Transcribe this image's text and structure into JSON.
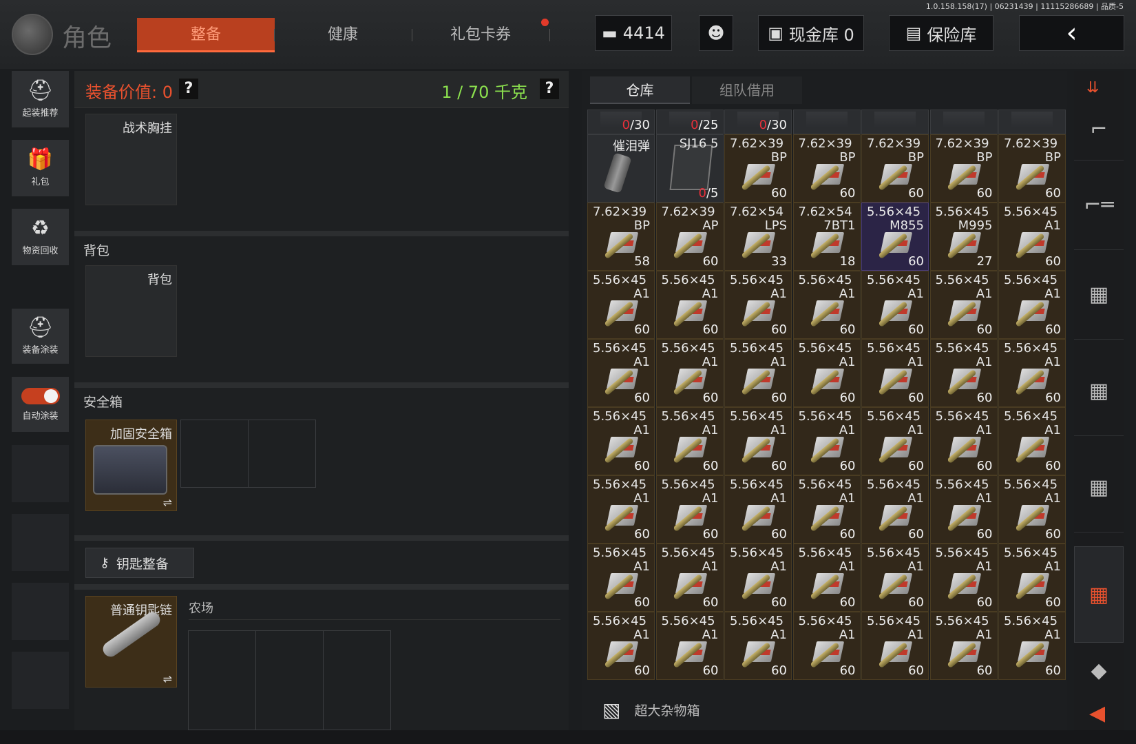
{
  "version": "1.0.158.158(17) | 06231439 | 11115286689 | 品质-5",
  "header": {
    "page_title": "角色",
    "tabs": [
      {
        "label": "整备",
        "active": true
      },
      {
        "label": "健康",
        "active": false
      },
      {
        "label": "礼包卡券",
        "active": false
      }
    ],
    "money": "4414",
    "cash_vault": "现金库 0",
    "insurance": "保险库",
    "back_icon": "back-arrow-icon"
  },
  "sidebar": [
    {
      "label": "起装推荐",
      "icon": "helmet-icon"
    },
    {
      "label": "礼包",
      "icon": "gift-icon"
    },
    {
      "label": "物资回收",
      "icon": "recycle-icon"
    },
    {
      "label": "装备涂装",
      "icon": "paint-icon"
    },
    {
      "label": "自动涂装",
      "icon": "toggle-icon"
    }
  ],
  "loadout": {
    "equip_value": "装备价值: 0",
    "weight": "1 / 70 千克",
    "help": "?",
    "chest_rig_label": "战术胸挂",
    "backpack_section": "背包",
    "backpack_slot": "背包",
    "safebox_section": "安全箱",
    "safebox_item": "加固安全箱",
    "key_button": "钥匙整备",
    "keychain_item": "普通钥匙链",
    "farm_label": "农场",
    "swap_icon": "⇌"
  },
  "warehouse": {
    "tabs": [
      {
        "label": "仓库",
        "active": true
      },
      {
        "label": "组队借用",
        "active": false
      }
    ],
    "misc_box": "超大杂物箱",
    "rows": [
      [
        {
          "name": "",
          "variant": "",
          "count": "/30",
          "count_red": "0",
          "kind": "partial"
        },
        {
          "name": "",
          "variant": "",
          "count": "/25",
          "count_red": "0",
          "kind": "partial"
        },
        {
          "name": "",
          "variant": "",
          "count": "/30",
          "count_red": "0",
          "kind": "partial"
        },
        {
          "name": "",
          "variant": "",
          "count": "",
          "count_red": "",
          "kind": "partial"
        },
        {
          "name": "",
          "variant": "",
          "count": "",
          "count_red": "",
          "kind": "partial"
        },
        {
          "name": "",
          "variant": "",
          "count": "",
          "count_red": "",
          "kind": "partial"
        },
        {
          "name": "",
          "variant": "",
          "count": "",
          "count_red": "",
          "kind": "partial"
        }
      ],
      [
        {
          "name": "催泪弹",
          "variant": "",
          "count": "",
          "count_red": "",
          "kind": "grenade"
        },
        {
          "name": "SJ16 5",
          "variant": "",
          "count": "/5",
          "count_red": "0",
          "kind": "magazine"
        },
        {
          "name": "7.62×39",
          "variant": "BP",
          "count": "60",
          "count_red": "",
          "kind": "ammo"
        },
        {
          "name": "7.62×39",
          "variant": "BP",
          "count": "60",
          "count_red": "",
          "kind": "ammo"
        },
        {
          "name": "7.62×39",
          "variant": "BP",
          "count": "60",
          "count_red": "",
          "kind": "ammo"
        },
        {
          "name": "7.62×39",
          "variant": "BP",
          "count": "60",
          "count_red": "",
          "kind": "ammo"
        },
        {
          "name": "7.62×39",
          "variant": "BP",
          "count": "60",
          "count_red": "",
          "kind": "ammo"
        }
      ],
      [
        {
          "name": "7.62×39",
          "variant": "BP",
          "count": "58",
          "count_red": "",
          "kind": "ammo"
        },
        {
          "name": "7.62×39",
          "variant": "AP",
          "count": "60",
          "count_red": "",
          "kind": "ammo"
        },
        {
          "name": "7.62×54",
          "variant": "LPS",
          "count": "33",
          "count_red": "",
          "kind": "ammo"
        },
        {
          "name": "7.62×54",
          "variant": "7BT1",
          "count": "18",
          "count_red": "",
          "kind": "ammo"
        },
        {
          "name": "5.56×45",
          "variant": "M855",
          "count": "60",
          "count_red": "",
          "kind": "ammo-purple"
        },
        {
          "name": "5.56×45",
          "variant": "M995",
          "count": "27",
          "count_red": "",
          "kind": "ammo"
        },
        {
          "name": "5.56×45",
          "variant": "A1",
          "count": "60",
          "count_red": "",
          "kind": "ammo"
        }
      ],
      [
        {
          "name": "5.56×45",
          "variant": "A1",
          "count": "60",
          "count_red": "",
          "kind": "ammo"
        },
        {
          "name": "5.56×45",
          "variant": "A1",
          "count": "60",
          "count_red": "",
          "kind": "ammo"
        },
        {
          "name": "5.56×45",
          "variant": "A1",
          "count": "60",
          "count_red": "",
          "kind": "ammo"
        },
        {
          "name": "5.56×45",
          "variant": "A1",
          "count": "60",
          "count_red": "",
          "kind": "ammo"
        },
        {
          "name": "5.56×45",
          "variant": "A1",
          "count": "60",
          "count_red": "",
          "kind": "ammo"
        },
        {
          "name": "5.56×45",
          "variant": "A1",
          "count": "60",
          "count_red": "",
          "kind": "ammo"
        },
        {
          "name": "5.56×45",
          "variant": "A1",
          "count": "60",
          "count_red": "",
          "kind": "ammo"
        }
      ],
      [
        {
          "name": "5.56×45",
          "variant": "A1",
          "count": "60",
          "count_red": "",
          "kind": "ammo"
        },
        {
          "name": "5.56×45",
          "variant": "A1",
          "count": "60",
          "count_red": "",
          "kind": "ammo"
        },
        {
          "name": "5.56×45",
          "variant": "A1",
          "count": "60",
          "count_red": "",
          "kind": "ammo"
        },
        {
          "name": "5.56×45",
          "variant": "A1",
          "count": "60",
          "count_red": "",
          "kind": "ammo"
        },
        {
          "name": "5.56×45",
          "variant": "A1",
          "count": "60",
          "count_red": "",
          "kind": "ammo"
        },
        {
          "name": "5.56×45",
          "variant": "A1",
          "count": "60",
          "count_red": "",
          "kind": "ammo"
        },
        {
          "name": "5.56×45",
          "variant": "A1",
          "count": "60",
          "count_red": "",
          "kind": "ammo"
        }
      ],
      [
        {
          "name": "5.56×45",
          "variant": "A1",
          "count": "60",
          "count_red": "",
          "kind": "ammo"
        },
        {
          "name": "5.56×45",
          "variant": "A1",
          "count": "60",
          "count_red": "",
          "kind": "ammo"
        },
        {
          "name": "5.56×45",
          "variant": "A1",
          "count": "60",
          "count_red": "",
          "kind": "ammo"
        },
        {
          "name": "5.56×45",
          "variant": "A1",
          "count": "60",
          "count_red": "",
          "kind": "ammo"
        },
        {
          "name": "5.56×45",
          "variant": "A1",
          "count": "60",
          "count_red": "",
          "kind": "ammo"
        },
        {
          "name": "5.56×45",
          "variant": "A1",
          "count": "60",
          "count_red": "",
          "kind": "ammo"
        },
        {
          "name": "5.56×45",
          "variant": "A1",
          "count": "60",
          "count_red": "",
          "kind": "ammo"
        }
      ],
      [
        {
          "name": "5.56×45",
          "variant": "A1",
          "count": "60",
          "count_red": "",
          "kind": "ammo"
        },
        {
          "name": "5.56×45",
          "variant": "A1",
          "count": "60",
          "count_red": "",
          "kind": "ammo"
        },
        {
          "name": "5.56×45",
          "variant": "A1",
          "count": "60",
          "count_red": "",
          "kind": "ammo"
        },
        {
          "name": "5.56×45",
          "variant": "A1",
          "count": "60",
          "count_red": "",
          "kind": "ammo"
        },
        {
          "name": "5.56×45",
          "variant": "A1",
          "count": "60",
          "count_red": "",
          "kind": "ammo"
        },
        {
          "name": "5.56×45",
          "variant": "A1",
          "count": "60",
          "count_red": "",
          "kind": "ammo"
        },
        {
          "name": "5.56×45",
          "variant": "A1",
          "count": "60",
          "count_red": "",
          "kind": "ammo"
        }
      ],
      [
        {
          "name": "5.56×45",
          "variant": "A1",
          "count": "60",
          "count_red": "",
          "kind": "ammo"
        },
        {
          "name": "5.56×45",
          "variant": "A1",
          "count": "60",
          "count_red": "",
          "kind": "ammo"
        },
        {
          "name": "5.56×45",
          "variant": "A1",
          "count": "60",
          "count_red": "",
          "kind": "ammo"
        },
        {
          "name": "5.56×45",
          "variant": "A1",
          "count": "60",
          "count_red": "",
          "kind": "ammo"
        },
        {
          "name": "5.56×45",
          "variant": "A1",
          "count": "60",
          "count_red": "",
          "kind": "ammo"
        },
        {
          "name": "5.56×45",
          "variant": "A1",
          "count": "60",
          "count_red": "",
          "kind": "ammo"
        },
        {
          "name": "5.56×45",
          "variant": "A1",
          "count": "60",
          "count_red": "",
          "kind": "ammo"
        }
      ],
      [
        {
          "name": "5.56×45",
          "variant": "A1",
          "count": "60",
          "count_red": "",
          "kind": "ammo"
        },
        {
          "name": "5.56×45",
          "variant": "A1",
          "count": "60",
          "count_red": "",
          "kind": "ammo"
        },
        {
          "name": "5.56×45",
          "variant": "A1",
          "count": "60",
          "count_red": "",
          "kind": "ammo"
        },
        {
          "name": "5.56×45",
          "variant": "A1",
          "count": "60",
          "count_red": "",
          "kind": "ammo"
        },
        {
          "name": "5.56×45",
          "variant": "A1",
          "count": "60",
          "count_red": "",
          "kind": "ammo"
        },
        {
          "name": "5.56×45",
          "variant": "A1",
          "count": "60",
          "count_red": "",
          "kind": "ammo"
        },
        {
          "name": "5.56×45",
          "variant": "A1",
          "count": "60",
          "count_red": "",
          "kind": "ammo"
        }
      ]
    ]
  },
  "right_rail": {
    "icons": [
      "sort-icon",
      "pistol-icon",
      "rifle-icon",
      "crate-icon",
      "crate-icon",
      "crate-icon",
      "crate-active-icon",
      "misc-box-icon"
    ],
    "collapse_icon": "collapse-arrow-icon"
  }
}
